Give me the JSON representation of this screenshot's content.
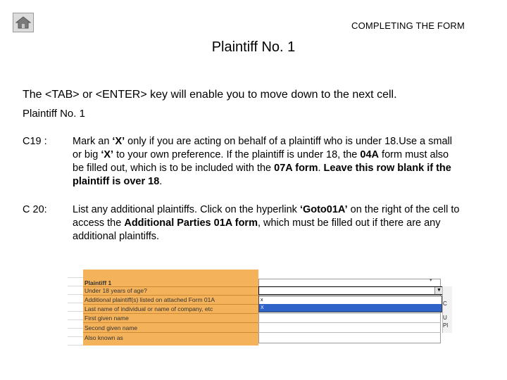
{
  "header": {
    "section_title": "COMPLETING THE FORM",
    "slide_title": "Plaintiff No. 1",
    "home_icon": "home-icon"
  },
  "intro": "The <TAB> or <ENTER> key will enable you to move down to the next cell.",
  "sub_heading": "Plaintiff No. 1",
  "items": [
    {
      "code": "C19 :",
      "parts": [
        {
          "t": "Mark an "
        },
        {
          "t": "‘X’",
          "b": true
        },
        {
          "t": " only if you are acting on behalf of a plaintiff who is under 18.Use a small or big "
        },
        {
          "t": "‘X’",
          "b": true
        },
        {
          "t": " to your own preference. If the plaintiff is under 18, the "
        },
        {
          "t": "04A",
          "b": true
        },
        {
          "t": " form must also be filled out, which is to be included  with the "
        },
        {
          "t": "07A form",
          "b": true
        },
        {
          "t": ". "
        },
        {
          "t": "Leave this row blank if the plaintiff is over 18",
          "b": true
        },
        {
          "t": "."
        }
      ]
    },
    {
      "code": "C 20:",
      "parts": [
        {
          "t": "List any additional plaintiffs. Click on the hyperlink "
        },
        {
          "t": "‘Goto01A’",
          "b": true
        },
        {
          "t": " on the right of the cell to access the "
        },
        {
          "t": "Additional Parties 01A form",
          "b": true
        },
        {
          "t": ", which must be filled out if there are any additional plaintiffs."
        }
      ]
    }
  ],
  "spreadsheet": {
    "header_row": "Plaintiff 1",
    "rows": [
      "Under 18 years of age?",
      "Additional plaintiff(s) listed on attached Form 01A",
      "Last name of individual or name of company, etc",
      "First given name",
      "Second given name",
      "Also known as"
    ],
    "dropdown_options": [
      "x",
      "X"
    ],
    "selected_option_index": 1,
    "right_snippets": [
      "C",
      "U",
      "Pl"
    ]
  }
}
